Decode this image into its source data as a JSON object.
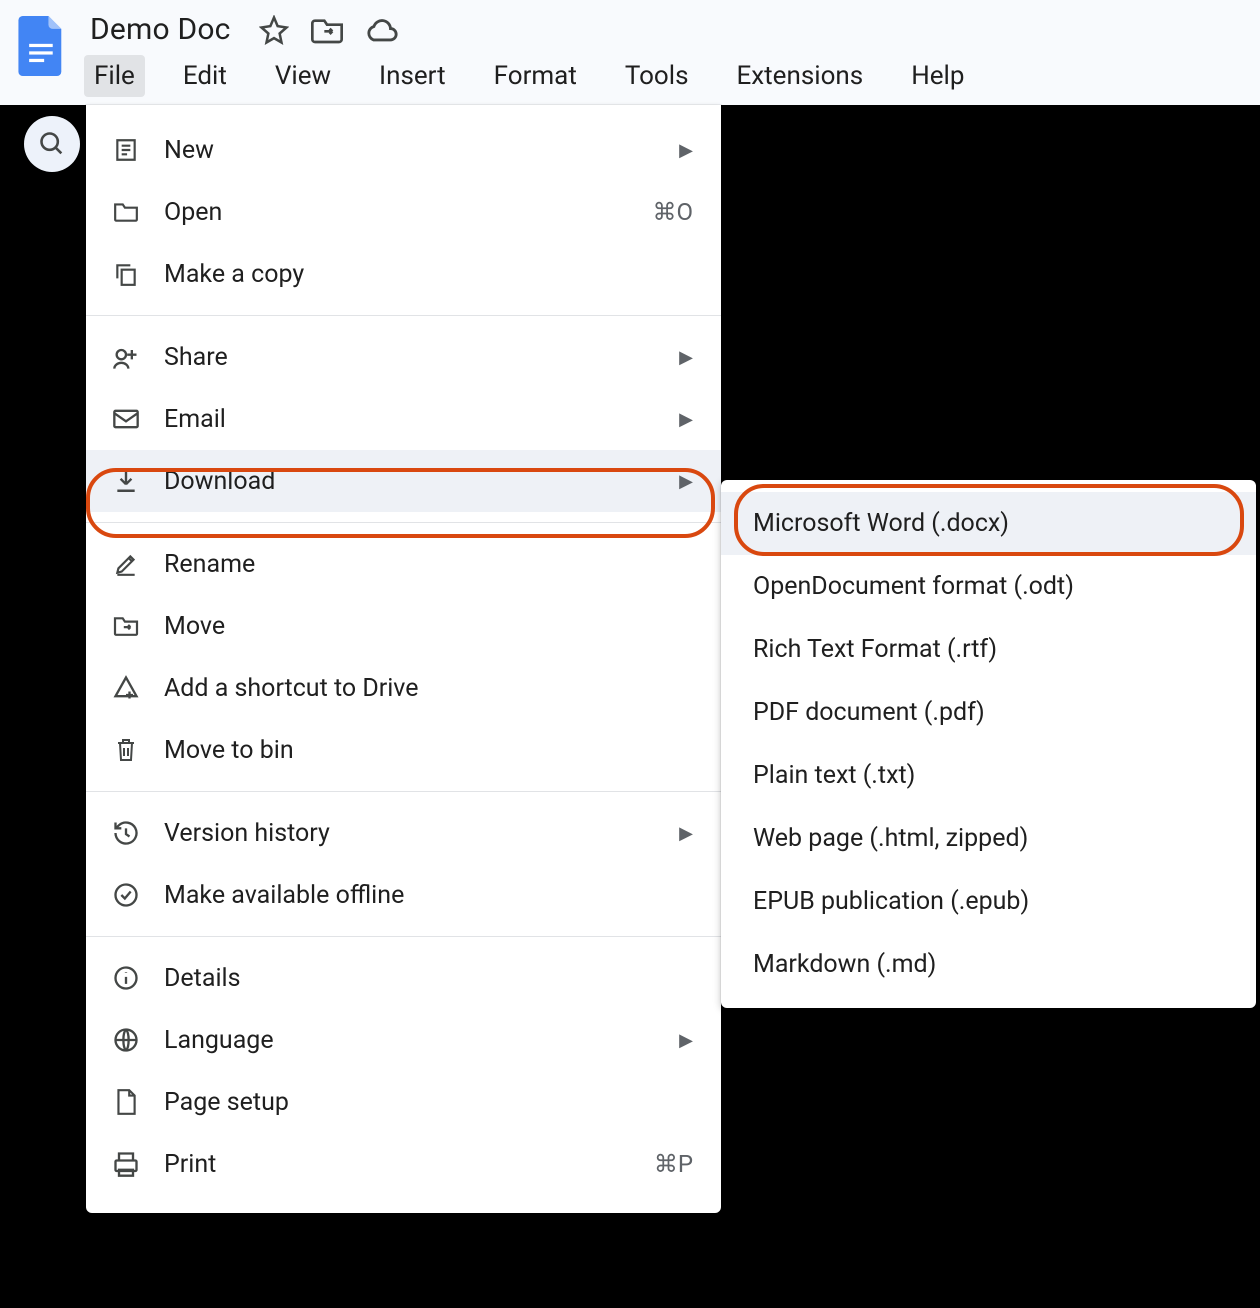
{
  "doc": {
    "title": "Demo Doc"
  },
  "menubar": {
    "file": "File",
    "edit": "Edit",
    "view": "View",
    "insert": "Insert",
    "format": "Format",
    "tools": "Tools",
    "extensions": "Extensions",
    "help": "Help"
  },
  "file_menu": {
    "new": "New",
    "open": "Open",
    "open_shortcut": "⌘O",
    "make_copy": "Make a copy",
    "share": "Share",
    "email": "Email",
    "download": "Download",
    "rename": "Rename",
    "move": "Move",
    "add_shortcut": "Add a shortcut to Drive",
    "move_to_bin": "Move to bin",
    "version_history": "Version history",
    "offline": "Make available offline",
    "details": "Details",
    "language": "Language",
    "page_setup": "Page setup",
    "print": "Print",
    "print_shortcut": "⌘P"
  },
  "download_menu": {
    "docx": "Microsoft Word (.docx)",
    "odt": "OpenDocument format (.odt)",
    "rtf": "Rich Text Format (.rtf)",
    "pdf": "PDF document (.pdf)",
    "txt": "Plain text (.txt)",
    "html": "Web page (.html, zipped)",
    "epub": "EPUB publication (.epub)",
    "md": "Markdown (.md)"
  }
}
